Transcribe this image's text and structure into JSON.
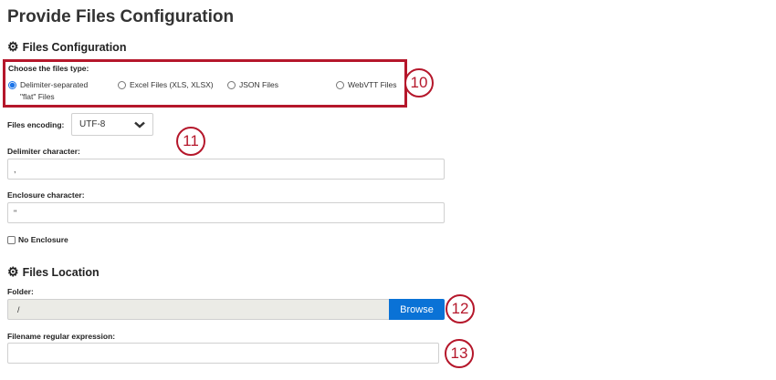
{
  "page_title": "Provide Files Configuration",
  "files_configuration": {
    "heading": "Files Configuration",
    "icon": "gear-icon",
    "file_type_label": "Choose the files type:",
    "file_types": [
      {
        "line1": "Delimiter-separated",
        "line2": "\"flat\" Files",
        "selected": true
      },
      {
        "line1": "Excel Files (XLS, XLSX)",
        "selected": false
      },
      {
        "line1": "JSON Files",
        "selected": false
      },
      {
        "line1": "WebVTT Files",
        "selected": false
      }
    ],
    "encoding_label": "Files encoding:",
    "encoding_value": "UTF-8",
    "delimiter_label": "Delimiter character:",
    "delimiter_value": ",",
    "enclosure_label": "Enclosure character:",
    "enclosure_value": "\"",
    "no_enclosure_label": "No Enclosure",
    "no_enclosure_checked": false
  },
  "files_location": {
    "heading": "Files Location",
    "icon": "gear-icon",
    "folder_label": "Folder:",
    "folder_value": "/",
    "browse_label": "Browse",
    "regex_label": "Filename regular expression:",
    "regex_value": ""
  },
  "callouts": [
    "10",
    "11",
    "12",
    "13"
  ],
  "colors": {
    "accent": "#b5172b",
    "button": "#0a72d6"
  }
}
